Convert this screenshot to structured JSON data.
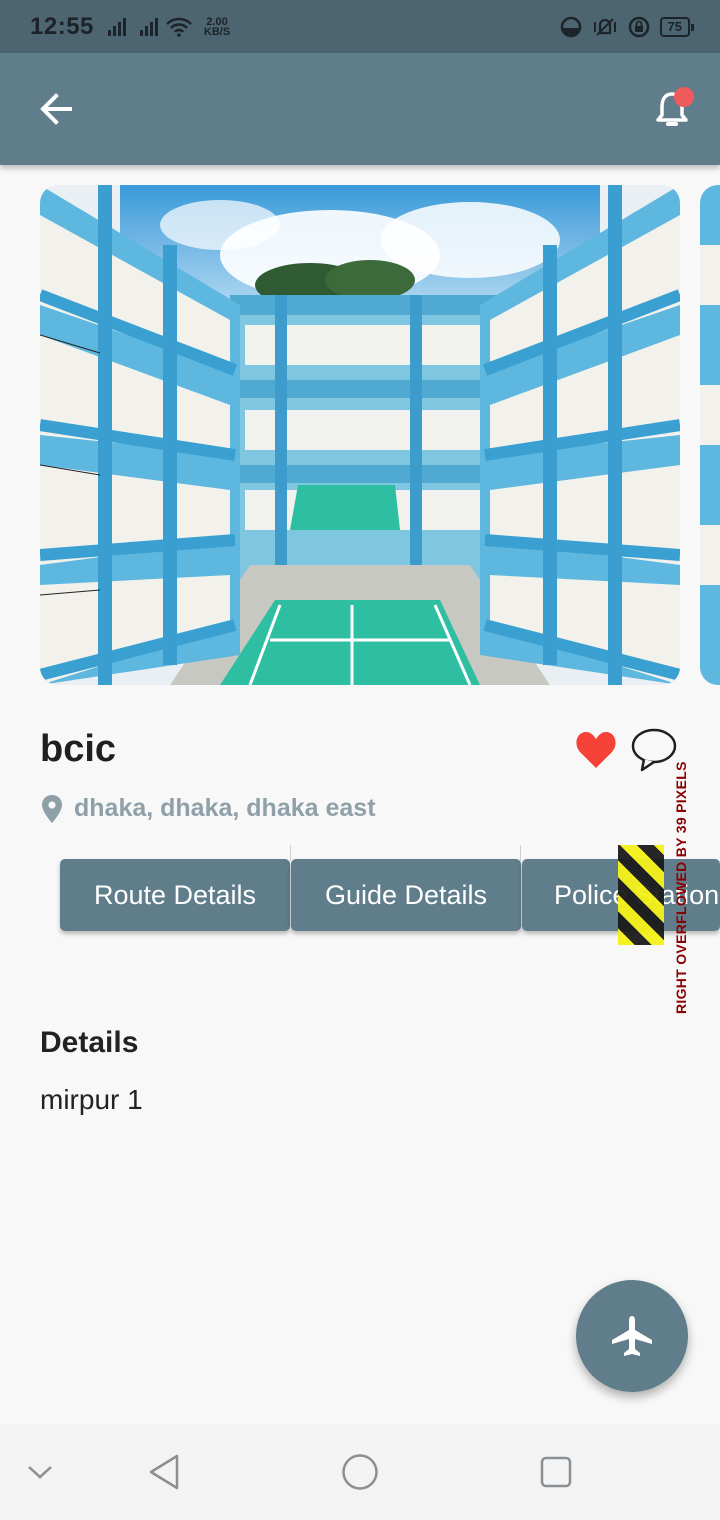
{
  "status_bar": {
    "time": "12:55",
    "speed_value": "2.00",
    "speed_unit": "KB/S",
    "battery": "75"
  },
  "app_bar": {
    "back_icon": "arrow-left-icon",
    "notification_icon": "bell-icon",
    "has_notification_dot": true
  },
  "place": {
    "name": "bcic",
    "location": "dhaka, dhaka, dhaka east",
    "favorite": true
  },
  "actions": [
    {
      "label": "Route Details"
    },
    {
      "label": "Guide Details"
    },
    {
      "label": "Police Station"
    }
  ],
  "debug_overflow": "RIGHT OVERFLOWED BY 39 PIXELS",
  "details": {
    "heading": "Details",
    "value": "mirpur 1"
  },
  "fab_icon": "airplane-icon",
  "colors": {
    "primary": "#607d8b",
    "heart": "#f44336",
    "notification_dot": "#ef5a5a"
  }
}
